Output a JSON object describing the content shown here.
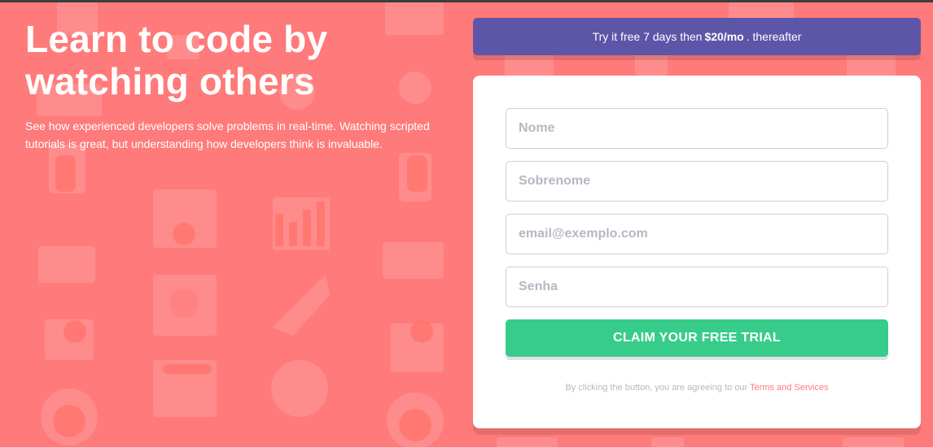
{
  "hero": {
    "title_line1": "Learn to code by",
    "title_line2": "watching others",
    "description": "See how experienced developers solve problems in real-time. Watching scripted tutorials is great, but understanding how developers think is invaluable."
  },
  "promo": {
    "prefix": "Try it free 7 days then",
    "price": "$20/mo",
    "suffix": ". thereafter"
  },
  "form": {
    "first_name_placeholder": "Nome",
    "last_name_placeholder": "Sobrenome",
    "email_placeholder": "email@exemplo.com",
    "password_placeholder": "Senha",
    "submit_label": "CLAIM YOUR FREE TRIAL",
    "terms_prefix": "By clicking the button, you are agreeing to our",
    "terms_link": "Terms and Services"
  },
  "colors": {
    "background": "#ff7a7a",
    "banner": "#5d55a8",
    "button": "#38cc8b",
    "link": "#ff7a7a"
  }
}
